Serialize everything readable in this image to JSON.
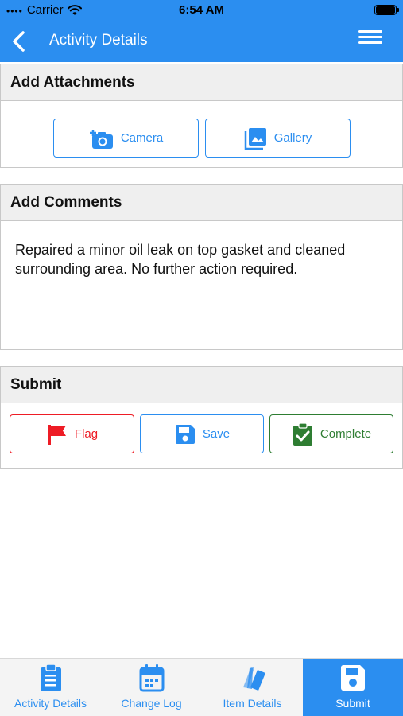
{
  "status_bar": {
    "carrier": "Carrier",
    "time": "6:54 AM"
  },
  "nav": {
    "title": "Activity Details"
  },
  "attachments": {
    "header": "Add Attachments",
    "camera_label": "Camera",
    "gallery_label": "Gallery"
  },
  "comments": {
    "header": "Add Comments",
    "text": "Repaired a minor oil leak on top gasket and cleaned surrounding area. No further action required."
  },
  "submit": {
    "header": "Submit",
    "flag_label": "Flag",
    "save_label": "Save",
    "complete_label": "Complete"
  },
  "tabs": [
    {
      "label": "Activity Details",
      "icon": "clipboard-icon"
    },
    {
      "label": "Change Log",
      "icon": "calendar-icon"
    },
    {
      "label": "Item Details",
      "icon": "tags-icon"
    },
    {
      "label": "Submit",
      "icon": "save-icon",
      "active": true
    }
  ],
  "colors": {
    "primary": "#2b8ef0",
    "flag": "#ee1c25",
    "complete": "#2e7d32",
    "section_header_bg": "#efefef"
  }
}
